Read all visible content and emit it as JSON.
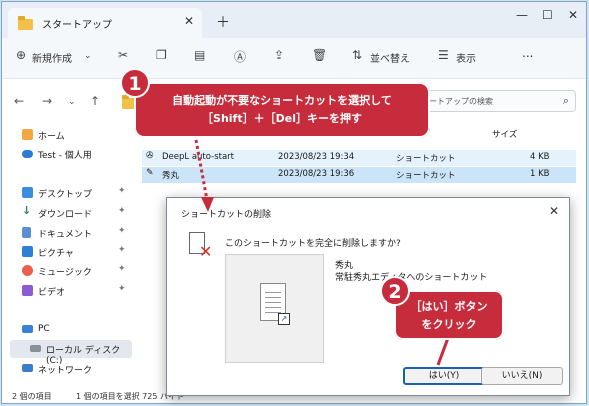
{
  "window": {
    "title": "スタートアップ",
    "controls": [
      "minimize-icon",
      "maximize-icon",
      "close-icon"
    ]
  },
  "toolbar": {
    "new_label": "新規作成",
    "sort_label": "並べ替え",
    "view_label": "表示",
    "more_label": "..."
  },
  "search": {
    "placeholder": "スタートアップの検索"
  },
  "columns": {
    "size": "サイズ"
  },
  "sidebar": {
    "items": [
      {
        "label": "ホーム",
        "icon": "home-icon"
      },
      {
        "label": "Test - 個人用",
        "icon": "cloud-icon"
      },
      {
        "label": "デスクトップ",
        "icon": "desktop-icon"
      },
      {
        "label": "ダウンロード",
        "icon": "download-icon"
      },
      {
        "label": "ドキュメント",
        "icon": "document-icon"
      },
      {
        "label": "ピクチャ",
        "icon": "picture-icon"
      },
      {
        "label": "ミュージック",
        "icon": "music-icon"
      },
      {
        "label": "ビデオ",
        "icon": "video-icon"
      },
      {
        "label": "PC",
        "icon": "pc-icon"
      },
      {
        "label": "ローカル ディスク (C:)",
        "icon": "disk-icon"
      },
      {
        "label": "ネットワーク",
        "icon": "network-icon"
      }
    ]
  },
  "files": [
    {
      "name": "DeepL auto-start",
      "date": "2023/08/23 19:34",
      "type": "ショートカット",
      "size": "4 KB"
    },
    {
      "name": "秀丸",
      "date": "2023/08/23 19:36",
      "type": "ショートカット",
      "size": "1 KB"
    }
  ],
  "status": {
    "count": "2 個の項目",
    "selected": "1 個の項目を選択  725 バイト"
  },
  "dialog": {
    "title": "ショートカットの削除",
    "question": "このショートカットを完全に削除しますか?",
    "item_name": "秀丸",
    "item_desc": "常駐秀丸エディタへのショートカット",
    "yes": "はい(Y)",
    "no": "いいえ(N)"
  },
  "callouts": {
    "one_number": "1",
    "one_line1": "自動起動が不要なショートカットを選択して",
    "one_line2": "［Shift］＋［Del］キーを押す",
    "two_number": "2",
    "two_line1": "［はい］ボタン",
    "two_line2": "をクリック"
  },
  "colors": {
    "accent": "#c62c3b",
    "selection": "#cce4f7",
    "folder": "#f1c14a"
  }
}
